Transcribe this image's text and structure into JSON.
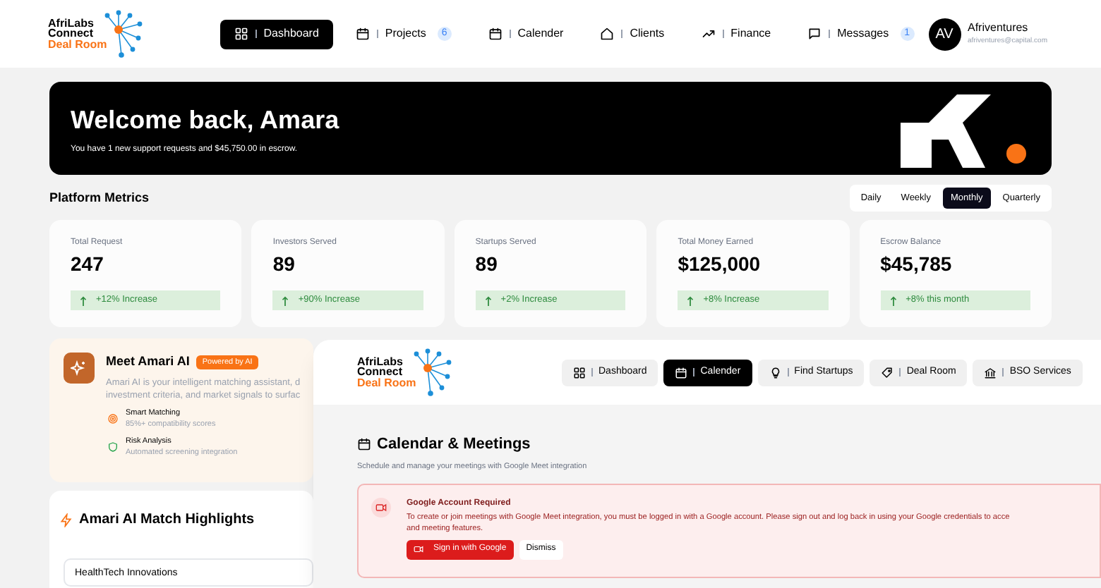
{
  "header": {
    "logo": {
      "line1": "AfriLabs",
      "line2": "Connect",
      "line3": "Deal Room"
    },
    "nav": [
      {
        "label": "Dashboard",
        "selected": true
      },
      {
        "label": "Projects",
        "badge": "6",
        "selected": false
      },
      {
        "label": "Calender",
        "selected": false
      },
      {
        "label": "Clients",
        "selected": false
      },
      {
        "label": "Finance",
        "selected": false
      },
      {
        "label": "Messages",
        "badge": "1",
        "selected": false
      }
    ],
    "user": {
      "initials": "AV",
      "name": "Afriventures",
      "email": "afriventures@capital.com"
    }
  },
  "banner": {
    "title": "Welcome back, Amara",
    "subtitle": "You have 1 new support requests and $45,750.00 in escrow."
  },
  "metrics": {
    "title": "Platform Metrics",
    "periods": [
      {
        "label": "Daily",
        "selected": false
      },
      {
        "label": "Weekly",
        "selected": false
      },
      {
        "label": "Monthly",
        "selected": true
      },
      {
        "label": "Quarterly",
        "selected": false
      }
    ],
    "cards": [
      {
        "label": "Total Request",
        "value": "247",
        "change": "+12% Increase"
      },
      {
        "label": "Investors Served",
        "value": "89",
        "change": "+90% Increase"
      },
      {
        "label": "Startups Served",
        "value": "89",
        "change": "+2% Increase"
      },
      {
        "label": "Total Money Earned",
        "value": "$125,000",
        "change": "+8% Increase"
      },
      {
        "label": "Escrow Balance",
        "value": "$45,785",
        "change": "+8% this month"
      }
    ]
  },
  "amari": {
    "title": "Meet Amari AI",
    "badge": "Powered by AI",
    "description": [
      "Amari AI is your intelligent matching assistant, d",
      "investment criteria, and market signals to surfac"
    ],
    "features": [
      {
        "title": "Smart Matching",
        "text": "85%+ compatibility scores"
      },
      {
        "title": "Risk Analysis",
        "text": "Automated screening integration"
      }
    ]
  },
  "highlights": {
    "title": "Amari AI Match Highlights",
    "items": [
      "HealthTech Innovations"
    ]
  },
  "inset": {
    "logo": {
      "line1": "AfriLabs",
      "line2": "Connect",
      "line3": "Deal Room"
    },
    "nav": [
      {
        "label": "Dashboard",
        "selected": false
      },
      {
        "label": "Calender",
        "selected": true
      },
      {
        "label": "Find Startups",
        "selected": false
      },
      {
        "label": "Deal Room",
        "selected": false
      },
      {
        "label": "BSO Services",
        "selected": false
      }
    ],
    "title": "Calendar & Meetings",
    "subtitle": "Schedule and manage your meetings with Google Meet integration",
    "alert": {
      "title": "Google Account Required",
      "lines": [
        "To create or join meetings with Google Meet integration, you must be logged in with a Google account. Please sign out and log back in using your Google credentials to acce",
        "and meeting features."
      ],
      "buttons": [
        {
          "label": "Sign in with Google",
          "kind": "primary"
        },
        {
          "label": "Dismiss",
          "kind": "secondary"
        }
      ]
    }
  }
}
